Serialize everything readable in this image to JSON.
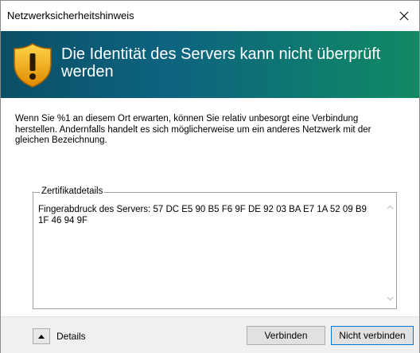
{
  "window": {
    "title": "Netzwerksicherheitshinweis"
  },
  "banner": {
    "headline": "Die Identität des Servers kann nicht überprüft werden",
    "icon": "shield-warning-icon",
    "colors": {
      "gradient_start": "#0a4f66",
      "gradient_end": "#108a63"
    }
  },
  "message": "Wenn Sie %1 an diesem Ort erwarten, können Sie relativ unbesorgt eine Verbindung herstellen. Andernfalls handelt es sich möglicherweise um ein anderes Netzwerk mit der gleichen Bezeichnung.",
  "certificate": {
    "legend": "Zertifikatdetails",
    "text": "Fingerabdruck des Servers: 57 DC E5 90 B5 F6 9F DE 92 03 BA E7 1A 52 09 B9 1F 46 94 9F"
  },
  "footer": {
    "details_label": "Details",
    "connect_label": "Verbinden",
    "dont_connect_label": "Nicht verbinden"
  }
}
